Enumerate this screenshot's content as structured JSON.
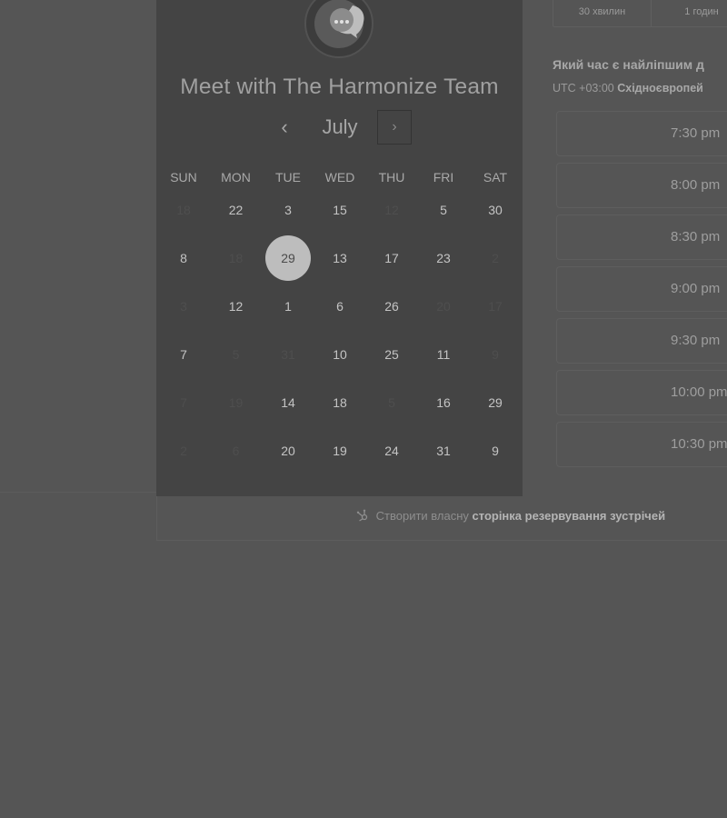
{
  "meeting": {
    "title": "Meet with The Harmonize Team",
    "avatar_icon": "chat-bubble-icon"
  },
  "calendar": {
    "month": "July",
    "prev_icon": "‹",
    "next_icon": "›",
    "weekdays": [
      "SUN",
      "MON",
      "TUE",
      "WED",
      "THU",
      "FRI",
      "SAT"
    ],
    "selected": "29",
    "weeks": [
      [
        {
          "d": "18",
          "a": false
        },
        {
          "d": "22",
          "a": true
        },
        {
          "d": "3",
          "a": true
        },
        {
          "d": "15",
          "a": true
        },
        {
          "d": "12",
          "a": false
        },
        {
          "d": "5",
          "a": true
        },
        {
          "d": "30",
          "a": true
        }
      ],
      [
        {
          "d": "8",
          "a": true
        },
        {
          "d": "18",
          "a": false
        },
        {
          "d": "29",
          "a": true,
          "selected": true
        },
        {
          "d": "13",
          "a": true
        },
        {
          "d": "17",
          "a": true
        },
        {
          "d": "23",
          "a": true
        },
        {
          "d": "2",
          "a": false
        }
      ],
      [
        {
          "d": "3",
          "a": false
        },
        {
          "d": "12",
          "a": true
        },
        {
          "d": "1",
          "a": true
        },
        {
          "d": "6",
          "a": true
        },
        {
          "d": "26",
          "a": true
        },
        {
          "d": "20",
          "a": false
        },
        {
          "d": "17",
          "a": false
        }
      ],
      [
        {
          "d": "7",
          "a": true
        },
        {
          "d": "5",
          "a": false
        },
        {
          "d": "31",
          "a": false
        },
        {
          "d": "10",
          "a": true
        },
        {
          "d": "25",
          "a": true
        },
        {
          "d": "11",
          "a": true
        },
        {
          "d": "9",
          "a": false
        }
      ],
      [
        {
          "d": "7",
          "a": false
        },
        {
          "d": "19",
          "a": false
        },
        {
          "d": "14",
          "a": true
        },
        {
          "d": "18",
          "a": true
        },
        {
          "d": "5",
          "a": false
        },
        {
          "d": "16",
          "a": true
        },
        {
          "d": "29",
          "a": true
        }
      ],
      [
        {
          "d": "2",
          "a": false
        },
        {
          "d": "6",
          "a": false
        },
        {
          "d": "20",
          "a": true
        },
        {
          "d": "19",
          "a": true
        },
        {
          "d": "24",
          "a": true
        },
        {
          "d": "31",
          "a": true
        },
        {
          "d": "9",
          "a": true
        }
      ]
    ]
  },
  "durations": [
    "30 хвилин",
    "1 годин"
  ],
  "time_section": {
    "question": "Який час є найліпшим д",
    "timezone_offset": "UTC +03:00",
    "timezone_name": "Східноєвропей"
  },
  "time_slots": [
    "7:30 pm",
    "8:00 pm",
    "8:30 pm",
    "9:00 pm",
    "9:30 pm",
    "10:00 pm",
    "10:30 pm"
  ],
  "footer": {
    "icon": "sprocket-icon",
    "prefix": "Створити власну",
    "link": "сторінка резервування зустрічей"
  }
}
